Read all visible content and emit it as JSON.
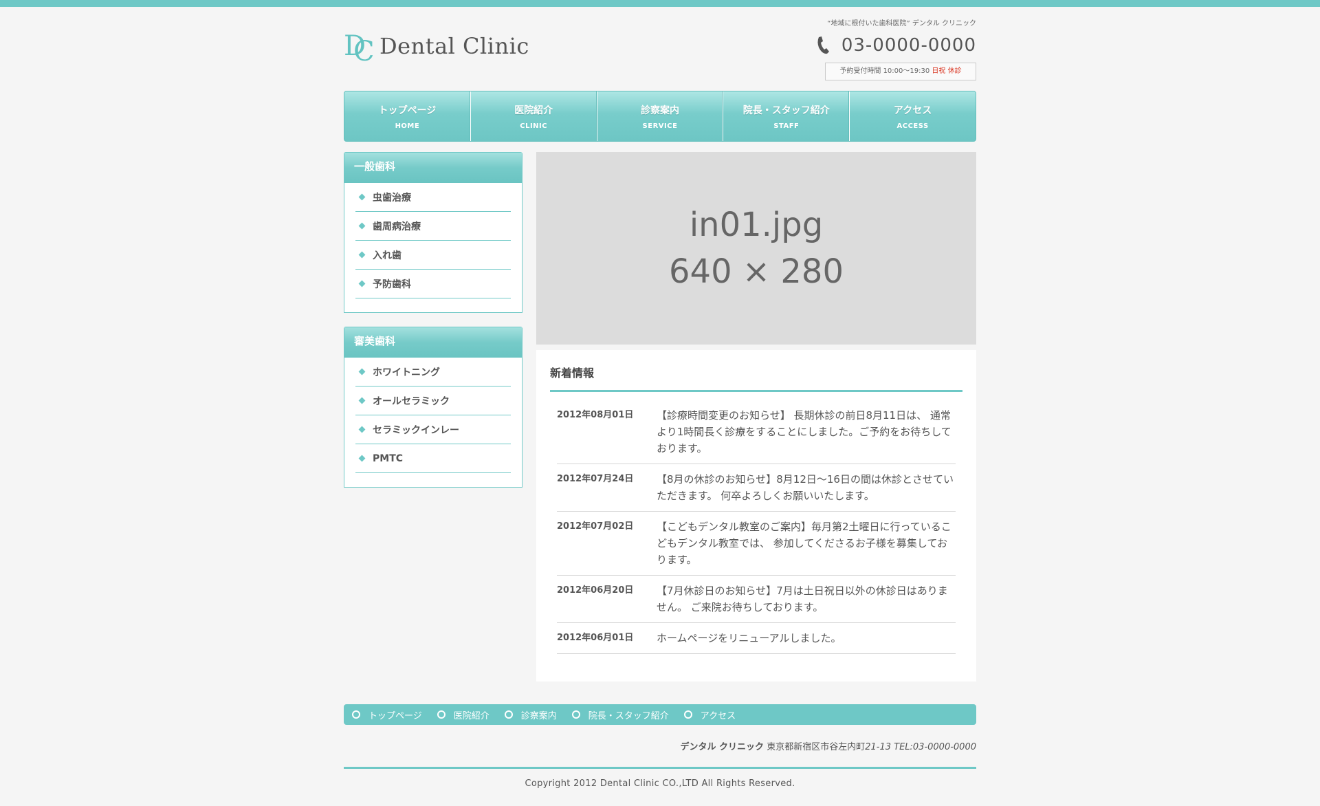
{
  "header": {
    "logo_text": "Dental Clinic",
    "logo_mark_d": "D",
    "logo_mark_c": "C",
    "tagline": "“地域に根付いた歯科医院” デンタル クリニック",
    "phone": "03-0000-0000",
    "hours_prefix": "予約受付時間 10:00～19:30",
    "hours_closed": "日祝 休診"
  },
  "nav": [
    {
      "jp": "トップページ",
      "en": "HOME"
    },
    {
      "jp": "医院紹介",
      "en": "CLINIC"
    },
    {
      "jp": "診察案内",
      "en": "SERVICE"
    },
    {
      "jp": "院長・スタッフ紹介",
      "en": "STAFF"
    },
    {
      "jp": "アクセス",
      "en": "ACCESS"
    }
  ],
  "sidebar": {
    "general": {
      "title": "一般歯科",
      "items": [
        "虫歯治療",
        "歯周病治療",
        "入れ歯",
        "予防歯科"
      ]
    },
    "cosmetic": {
      "title": "審美歯科",
      "items": [
        "ホワイトニング",
        "オールセラミック",
        "セラミックインレー",
        "PMTC"
      ]
    }
  },
  "hero": {
    "line1": "in01.jpg",
    "line2": "640 × 280"
  },
  "news": {
    "title": "新着情報",
    "items": [
      {
        "date": "2012年08月01日",
        "text": "【診療時間変更のお知らせ】 長期休診の前日8月11日は、 通常より1時間長く診療をすることにしました。ご予約をお待ちしております。"
      },
      {
        "date": "2012年07月24日",
        "text": "【8月の休診のお知らせ】8月12日～16日の間は休診とさせていただきます。 何卒よろしくお願いいたします。"
      },
      {
        "date": "2012年07月02日",
        "text": "【こどもデンタル教室のご案内】毎月第2土曜日に行っているこどもデンタル教室では、 参加してくださるお子様を募集しております。"
      },
      {
        "date": "2012年06月20日",
        "text": "【7月休診日のお知らせ】7月は土日祝日以外の休診日はありません。 ご来院お待ちしております。"
      },
      {
        "date": "2012年06月01日",
        "text": "ホームページをリニューアルしました。"
      }
    ]
  },
  "footer": {
    "nav": [
      "トップページ",
      "医院紹介",
      "診察案内",
      "院長・スタッフ紹介",
      "アクセス"
    ],
    "clinic_name": "デンタル クリニック",
    "address": "東京都新宿区市谷左内町",
    "address_tail": "21-13 TEL:03-0000-0000",
    "copyright": "Copyright 2012 Dental Clinic CO.,LTD All Rights Reserved."
  },
  "colors": {
    "accent": "#6ec8c6",
    "closed_red": "#d9331f",
    "hero_bg": "#dcdcdc"
  },
  "icons": {
    "phone": "phone-icon",
    "bullet": "diamond-bullet-icon",
    "footer_bullet": "ring-bullet-icon"
  }
}
